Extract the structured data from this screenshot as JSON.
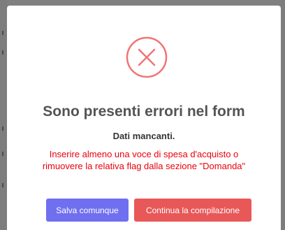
{
  "dialog": {
    "icon": "error-x-circle-icon",
    "title": "Sono presenti errori nel form",
    "subtitle": "Dati mancanti.",
    "error_lines": [
      "Inserire almeno una voce di spesa d'acquisto o",
      "rimuovere la relativa flag dalla sezione \"Domanda\""
    ],
    "buttons": {
      "save_label": "Salva comunque",
      "continue_label": "Continua la compilazione"
    }
  },
  "colors": {
    "error_icon": "#f27474",
    "error_text": "#e8000b",
    "save_button": "#6f6ff0",
    "continue_button": "#e85858",
    "backdrop": "#808080"
  }
}
